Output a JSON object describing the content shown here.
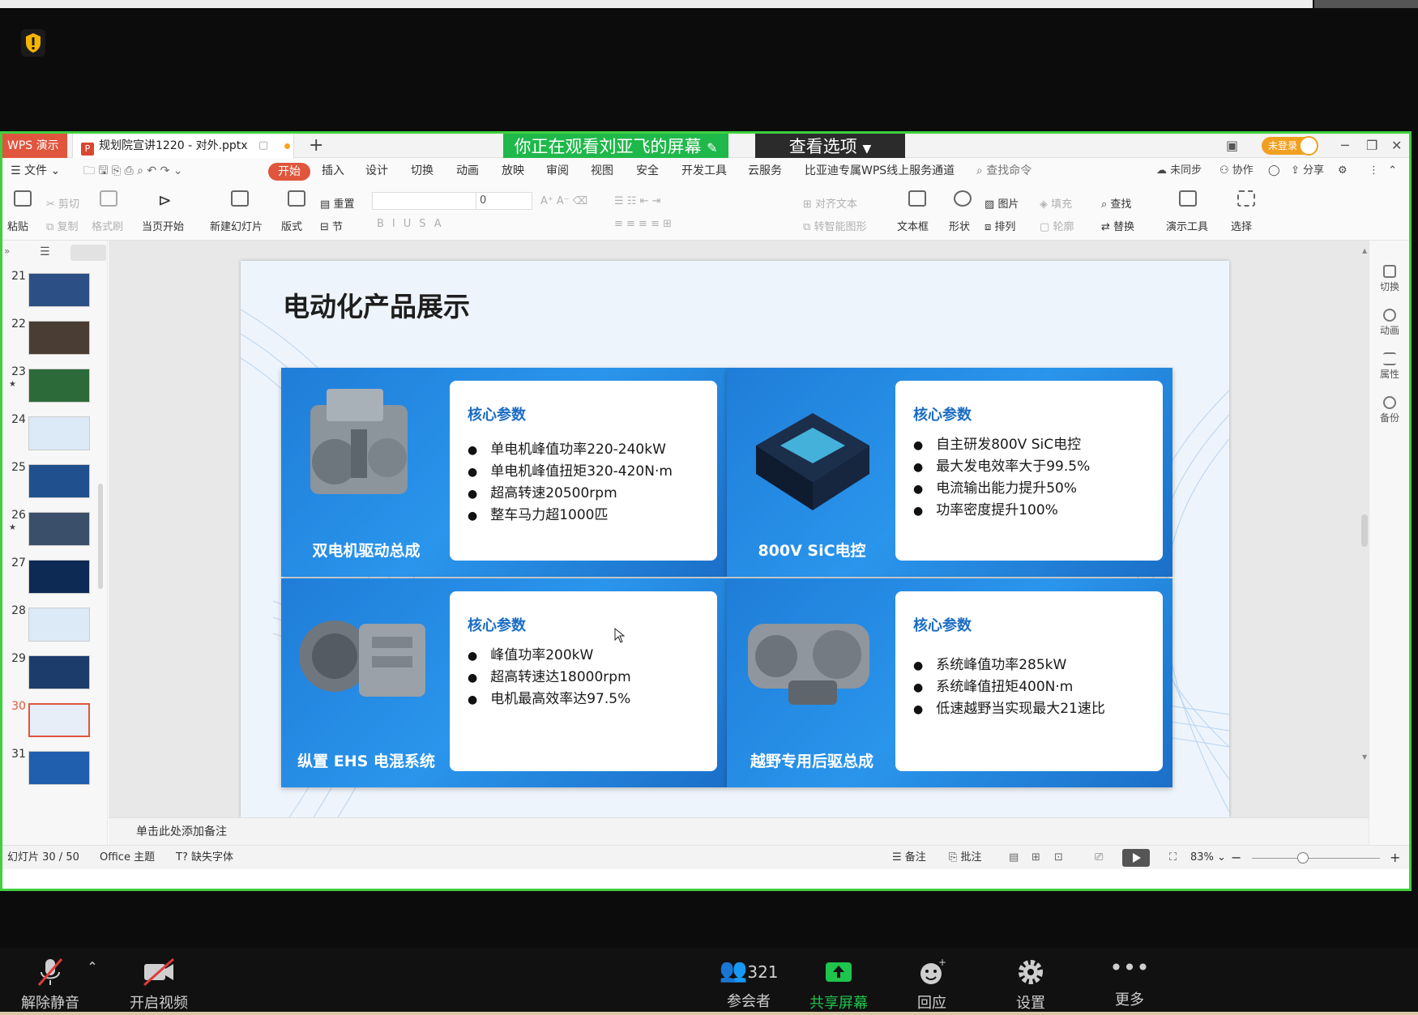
{
  "top": {
    "shield": "shield-alert-icon"
  },
  "window": {
    "app_tag": "WPS 演示",
    "doc_tab": "规划院宣讲1220 - 对外.pptx",
    "new_tab": "+",
    "share_banner": "你正在观看刘亚飞的屏幕",
    "view_options": "查看选项",
    "login": "未登录"
  },
  "menu": {
    "file": "文件",
    "items": [
      "开始",
      "插入",
      "设计",
      "切换",
      "动画",
      "放映",
      "审阅",
      "视图",
      "安全",
      "开发工具",
      "云服务",
      "比亚迪专属WPS线上服务通道"
    ],
    "search": "查找命令",
    "sync": "未同步",
    "collab": "协作",
    "share": "分享"
  },
  "ribbon": {
    "paste": "粘贴",
    "cut": "剪切",
    "copy": "复制",
    "format_painter": "格式刷",
    "from_current": "当页开始",
    "new_slide": "新建幻灯片",
    "layout": "版式",
    "reset": "重置",
    "section": "节",
    "font_size": "0",
    "align_text": "对齐文本",
    "smart_shape": "转智能图形",
    "textbox": "文本框",
    "shape": "形状",
    "picture": "图片",
    "arrange": "排列",
    "fill": "填充",
    "outline": "轮廓",
    "find": "查找",
    "replace": "替换",
    "present_tools": "演示工具",
    "select": "选择"
  },
  "slides_panel": {
    "numbers": [
      "21",
      "22",
      "23",
      "24",
      "25",
      "26",
      "27",
      "28",
      "29",
      "30",
      "31"
    ],
    "active": "30"
  },
  "right_panel": [
    "切换",
    "动画",
    "属性",
    "备份"
  ],
  "slide": {
    "title": "电动化产品展示",
    "cards": [
      {
        "name": "双电机驱动总成",
        "param_title": "核心参数",
        "params": [
          "单电机峰值功率220-240kW",
          "单电机峰值扭矩320-420N·m",
          "超高转速20500rpm",
          "整车马力超1000匹"
        ]
      },
      {
        "name": "800V SiC电控",
        "param_title": "核心参数",
        "params": [
          "自主研发800V SiC电控",
          "最大发电效率大于99.5%",
          "电流输出能力提升50%",
          "功率密度提升100%"
        ]
      },
      {
        "name": "纵置 EHS 电混系统",
        "param_title": "核心参数",
        "params": [
          "峰值功率200kW",
          "超高转速达18000rpm",
          "电机最高效率达97.5%"
        ]
      },
      {
        "name": "越野专用后驱总成",
        "param_title": "核心参数",
        "params": [
          "系统峰值功率285kW",
          "系统峰值扭矩400N·m",
          "低速越野当实现最大21速比"
        ]
      }
    ]
  },
  "notes": "单击此处添加备注",
  "status": {
    "slide_count": "幻灯片 30 / 50",
    "theme": "Office 主题",
    "missing_font": "缺失字体",
    "notes_btn": "备注",
    "comment_btn": "批注",
    "zoom": "83%"
  },
  "meeting": {
    "unmute": "解除静音",
    "start_video": "开启视频",
    "participants_count": "321",
    "participants": "参会者",
    "share_screen": "共享屏幕",
    "react": "回应",
    "settings": "设置",
    "more": "更多"
  },
  "colors": {
    "accent_wps": "#e0553d",
    "share_green": "#1fb84a",
    "slide_blue": "#2a95ec",
    "param_title": "#1a6cc4"
  }
}
